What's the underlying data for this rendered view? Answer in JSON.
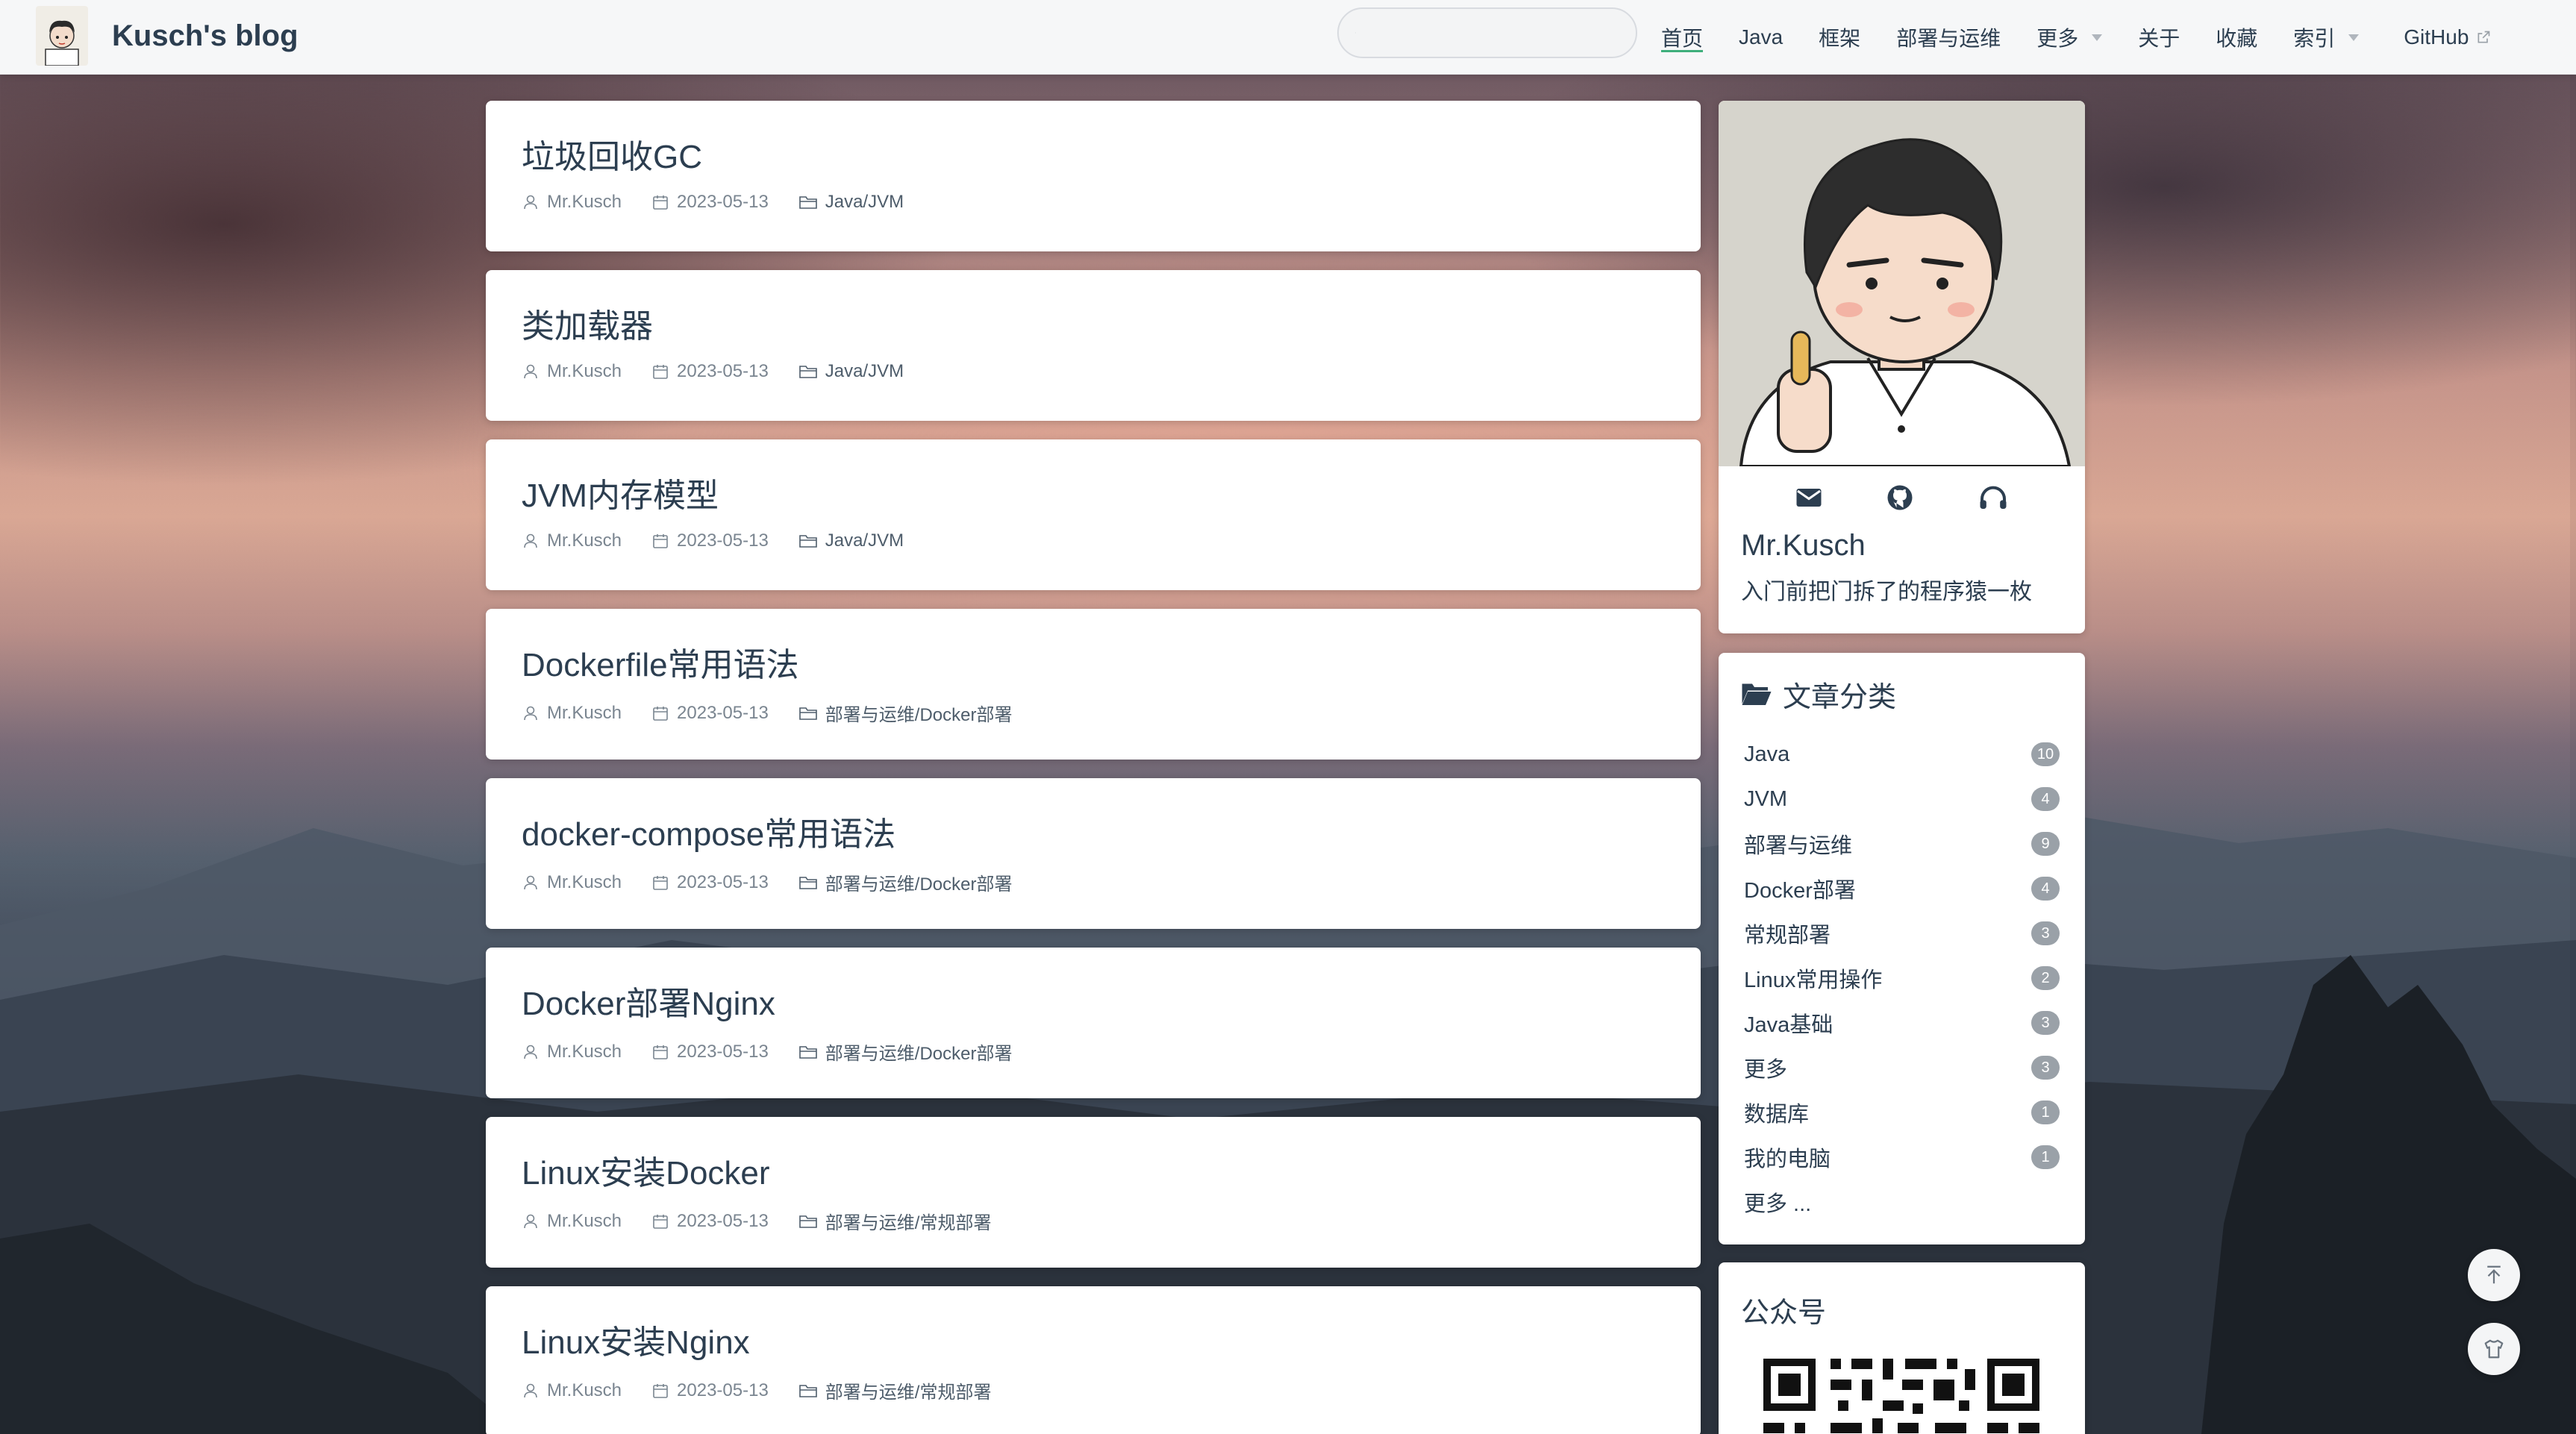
{
  "brand": {
    "title": "Kusch's blog"
  },
  "search": {
    "placeholder": ""
  },
  "nav": {
    "items": [
      {
        "label": "首页"
      },
      {
        "label": "Java"
      },
      {
        "label": "框架"
      },
      {
        "label": "部署与运维"
      },
      {
        "label": "更多"
      },
      {
        "label": "关于"
      },
      {
        "label": "收藏"
      },
      {
        "label": "索引"
      },
      {
        "label": "GitHub"
      }
    ]
  },
  "posts": [
    {
      "title": "垃圾回收GC",
      "author": "Mr.Kusch",
      "date": "2023-05-13",
      "category": "Java/JVM"
    },
    {
      "title": "类加载器",
      "author": "Mr.Kusch",
      "date": "2023-05-13",
      "category": "Java/JVM"
    },
    {
      "title": "JVM内存模型",
      "author": "Mr.Kusch",
      "date": "2023-05-13",
      "category": "Java/JVM"
    },
    {
      "title": "Dockerfile常用语法",
      "author": "Mr.Kusch",
      "date": "2023-05-13",
      "category": "部署与运维/Docker部署"
    },
    {
      "title": "docker-compose常用语法",
      "author": "Mr.Kusch",
      "date": "2023-05-13",
      "category": "部署与运维/Docker部署"
    },
    {
      "title": "Docker部署Nginx",
      "author": "Mr.Kusch",
      "date": "2023-05-13",
      "category": "部署与运维/Docker部署"
    },
    {
      "title": "Linux安装Docker",
      "author": "Mr.Kusch",
      "date": "2023-05-13",
      "category": "部署与运维/常规部署"
    },
    {
      "title": "Linux安装Nginx",
      "author": "Mr.Kusch",
      "date": "2023-05-13",
      "category": "部署与运维/常规部署"
    }
  ],
  "profile": {
    "name": "Mr.Kusch",
    "motto": "入门前把门拆了的程序猿一枚",
    "icons": [
      "mail-icon",
      "github-icon",
      "headphones-icon"
    ]
  },
  "categories": {
    "title": "文章分类",
    "items": [
      {
        "name": "Java",
        "count": "10"
      },
      {
        "name": "JVM",
        "count": "4"
      },
      {
        "name": "部署与运维",
        "count": "9"
      },
      {
        "name": "Docker部署",
        "count": "4"
      },
      {
        "name": "常规部署",
        "count": "3"
      },
      {
        "name": "Linux常用操作",
        "count": "2"
      },
      {
        "name": "Java基础",
        "count": "3"
      },
      {
        "name": "更多",
        "count": "3"
      },
      {
        "name": "数据库",
        "count": "1"
      },
      {
        "name": "我的电脑",
        "count": "1"
      }
    ],
    "more": "更多 ..."
  },
  "wechat": {
    "title": "公众号"
  },
  "colors": {
    "accent": "#3eaf7c",
    "text": "#2c3e50",
    "badge": "#9aa1a8"
  }
}
